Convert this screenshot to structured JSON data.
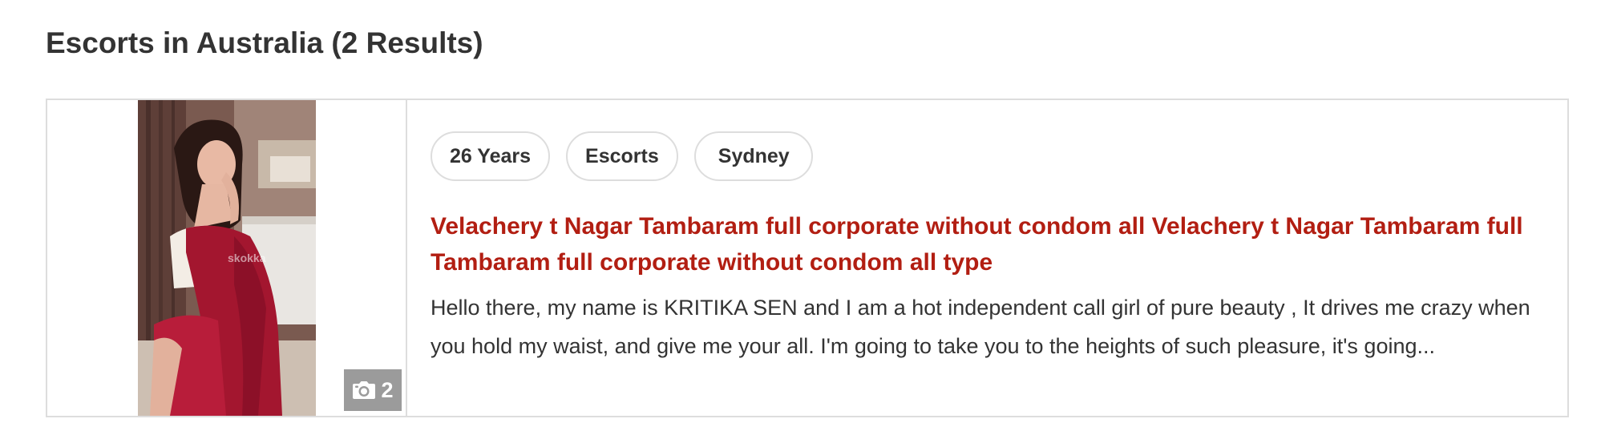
{
  "results": {
    "heading": "Escorts in Australia (2 Results)"
  },
  "listing": {
    "photo_count": "2",
    "tags": {
      "age": "26 Years",
      "category": "Escorts",
      "city": "Sydney"
    },
    "title": "Velachery t Nagar Tambaram full corporate without condom all Velachery t Nagar Tambaram full Tambaram full corporate without condom all type",
    "description": "Hello there, my name is KRITIKA SEN and I am a hot independent call girl of pure beauty , It drives me crazy when you hold my waist, and give me your all. I'm going to take you to the heights of such pleasure, it's going...",
    "photo_watermark": "skokka"
  },
  "colors": {
    "title_red": "#b21e12",
    "border_gray": "#dddddd",
    "badge_gray": "#9b9b9b",
    "text_dark": "#333333"
  },
  "icons": {
    "photo_count": "camera-icon"
  }
}
